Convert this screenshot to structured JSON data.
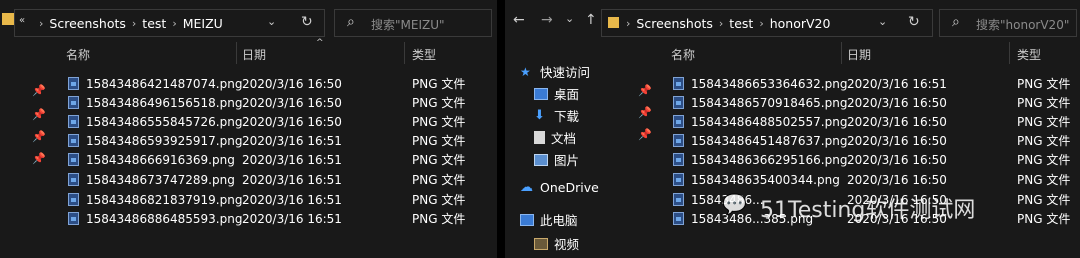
{
  "left": {
    "breadcrumbs": [
      "Screenshots",
      "test",
      "MEIZU"
    ],
    "search_placeholder": "搜索\"MEIZU\"",
    "columns": {
      "name": "名称",
      "date": "日期",
      "type": "类型"
    },
    "files": [
      {
        "name": "15843486421487074.png",
        "date": "2020/3/16 16:50",
        "type": "PNG 文件"
      },
      {
        "name": "15843486496156518.png",
        "date": "2020/3/16 16:50",
        "type": "PNG 文件"
      },
      {
        "name": "15843486555845726.png",
        "date": "2020/3/16 16:50",
        "type": "PNG 文件"
      },
      {
        "name": "15843486593925917.png",
        "date": "2020/3/16 16:51",
        "type": "PNG 文件"
      },
      {
        "name": "1584348666916369.png",
        "date": "2020/3/16 16:51",
        "type": "PNG 文件"
      },
      {
        "name": "1584348673747289.png",
        "date": "2020/3/16 16:51",
        "type": "PNG 文件"
      },
      {
        "name": "15843486821837919.png",
        "date": "2020/3/16 16:51",
        "type": "PNG 文件"
      },
      {
        "name": "15843486886485593.png",
        "date": "2020/3/16 16:51",
        "type": "PNG 文件"
      }
    ]
  },
  "right": {
    "breadcrumbs": [
      "Screenshots",
      "test",
      "honorV20"
    ],
    "search_placeholder": "搜索\"honorV20\"",
    "columns": {
      "name": "名称",
      "date": "日期",
      "type": "类型"
    },
    "files": [
      {
        "name": "15843486653364632.png",
        "date": "2020/3/16 16:51",
        "type": "PNG 文件"
      },
      {
        "name": "15843486570918465.png",
        "date": "2020/3/16 16:50",
        "type": "PNG 文件"
      },
      {
        "name": "15843486488502557.png",
        "date": "2020/3/16 16:50",
        "type": "PNG 文件"
      },
      {
        "name": "15843486451487637.png",
        "date": "2020/3/16 16:50",
        "type": "PNG 文件"
      },
      {
        "name": "15843486366295166.png",
        "date": "2020/3/16 16:50",
        "type": "PNG 文件"
      },
      {
        "name": "1584348635400344.png",
        "date": "2020/3/16 16:50",
        "type": "PNG 文件"
      },
      {
        "name": "15843486...",
        "date": "2020/3/16 16:50",
        "type": "PNG 文件"
      },
      {
        "name": "15843486...385.png",
        "date": "2020/3/16 16:50",
        "type": "PNG 文件"
      }
    ]
  },
  "nav": {
    "quick_access": "快速访问",
    "desktop": "桌面",
    "downloads": "下载",
    "documents": "文档",
    "pictures": "图片",
    "onedrive": "OneDrive",
    "this_pc": "此电脑",
    "videos": "视频"
  },
  "watermark": "51Testing软件测试网",
  "colors": {
    "background": "#191919",
    "accent": "#0078d7",
    "folder": "#e8b84a"
  }
}
